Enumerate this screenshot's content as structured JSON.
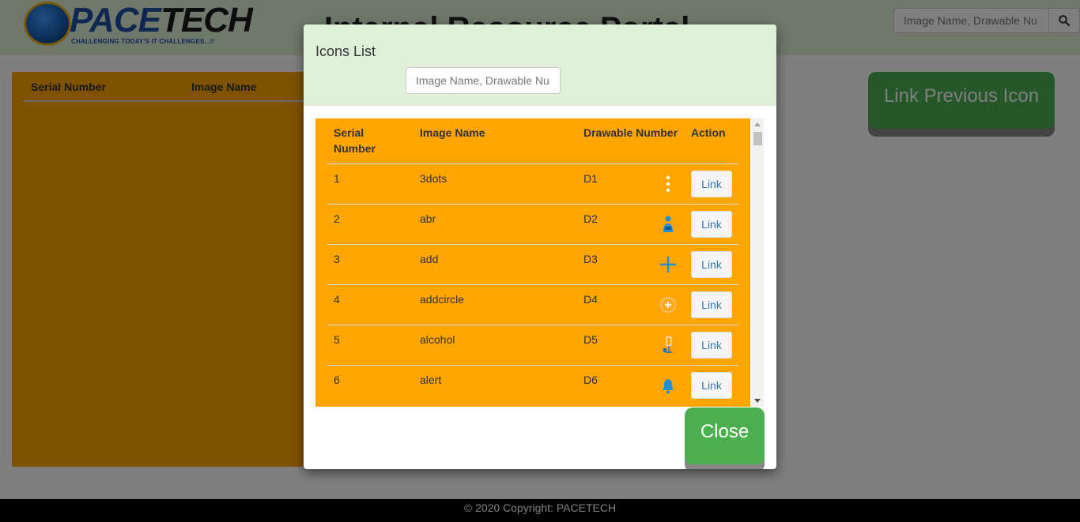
{
  "brand": {
    "name_part1": "PACE",
    "name_part2": "TECH",
    "tagline": "CHALLENGING TODAY'S IT CHALLENGES...!!"
  },
  "header": {
    "title": "Internal Resource Portal",
    "search_placeholder": "Image Name, Drawable Nu"
  },
  "background_table": {
    "columns": [
      "Serial Number",
      "Image Name"
    ]
  },
  "link_previous_label": "Link Previous Icon",
  "modal": {
    "title": "Icons List",
    "search_placeholder": "Image Name, Drawable Number",
    "columns": {
      "serial": "Serial Number",
      "image": "Image Name",
      "drawable": "Drawable Number",
      "action": "Action"
    },
    "rows": [
      {
        "serial": "1",
        "image": "3dots",
        "drawable": "D1",
        "icon": "three-dots-vertical-icon",
        "action": "Link"
      },
      {
        "serial": "2",
        "image": "abr",
        "drawable": "D2",
        "icon": "person-icon",
        "action": "Link"
      },
      {
        "serial": "3",
        "image": "add",
        "drawable": "D3",
        "icon": "plus-icon",
        "action": "Link"
      },
      {
        "serial": "4",
        "image": "addcircle",
        "drawable": "D4",
        "icon": "add-circle-icon",
        "action": "Link"
      },
      {
        "serial": "5",
        "image": "alcohol",
        "drawable": "D5",
        "icon": "wine-glass-icon",
        "action": "Link"
      },
      {
        "serial": "6",
        "image": "alert",
        "drawable": "D6",
        "icon": "bell-icon",
        "action": "Link"
      }
    ],
    "close_label": "Close"
  },
  "footer": {
    "copyright": "© 2020 Copyright: PACETECH"
  },
  "colors": {
    "table_bg": "#ffa500",
    "header_bg": "#dff0d8",
    "button_green": "#4caf50",
    "icon_blue": "#1e90e0"
  }
}
